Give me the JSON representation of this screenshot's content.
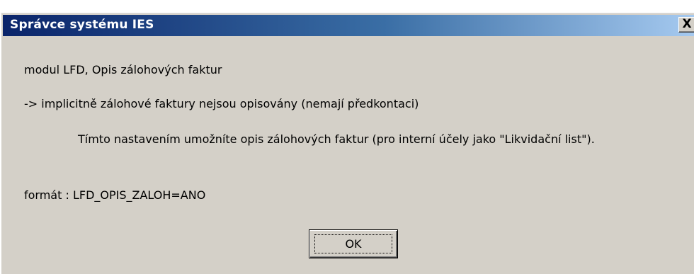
{
  "dialog": {
    "title": "Správce systému IES",
    "close_label": "X",
    "lines": [
      "modul LFD, Opis zálohových faktur",
      "-> implicitně zálohové faktury nejsou opisovány (nemají předkontaci)",
      "Tímto nastavením umožníte opis zálohových faktur (pro interní účely jako \"Likvidační list\").",
      "formát : LFD_OPIS_ZALOH=ANO"
    ],
    "ok_label": "OK"
  }
}
